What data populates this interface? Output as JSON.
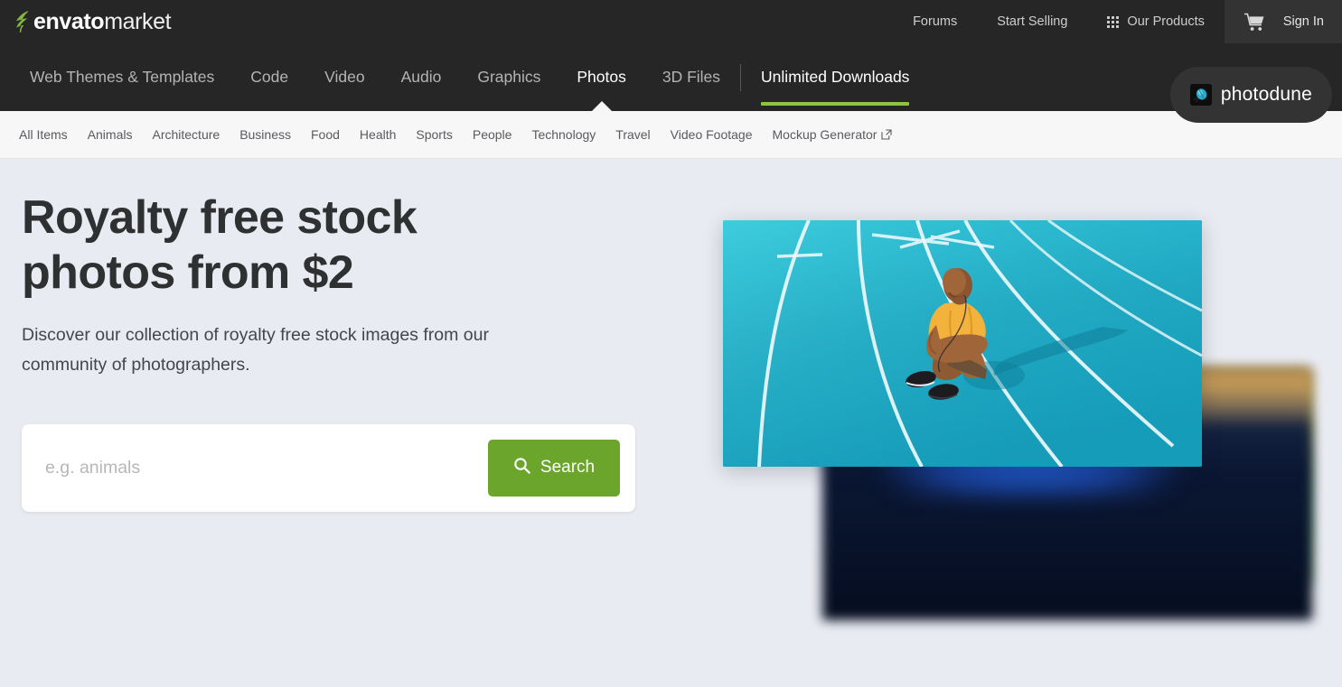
{
  "topbar": {
    "logo": {
      "primary": "envato",
      "secondary": "market",
      "leaf_icon": "envato-leaf-icon",
      "leaf_color": "#82b541"
    },
    "links": [
      {
        "label": "Forums",
        "name": "topnav-forums"
      },
      {
        "label": "Start Selling",
        "name": "topnav-start-selling"
      }
    ],
    "our_products": {
      "label": "Our Products",
      "icon": "grid-icon"
    },
    "sign_in": {
      "label": "Sign In",
      "icon": "cart-icon"
    }
  },
  "mainnav": {
    "items": [
      {
        "label": "Web Themes & Templates",
        "active": false
      },
      {
        "label": "Code",
        "active": false
      },
      {
        "label": "Video",
        "active": false
      },
      {
        "label": "Audio",
        "active": false
      },
      {
        "label": "Graphics",
        "active": false
      },
      {
        "label": "Photos",
        "active": true
      },
      {
        "label": "3D Files",
        "active": false
      }
    ],
    "promo": {
      "label": "Unlimited Downloads",
      "underline_color": "#8cc63f"
    },
    "brand_pill": {
      "label": "photodune",
      "icon": "photodune-beetle-icon"
    }
  },
  "subnav": {
    "items": [
      {
        "label": "All Items",
        "external": false
      },
      {
        "label": "Animals",
        "external": false
      },
      {
        "label": "Architecture",
        "external": false
      },
      {
        "label": "Business",
        "external": false
      },
      {
        "label": "Food",
        "external": false
      },
      {
        "label": "Health",
        "external": false
      },
      {
        "label": "Sports",
        "external": false
      },
      {
        "label": "People",
        "external": false
      },
      {
        "label": "Technology",
        "external": false
      },
      {
        "label": "Travel",
        "external": false
      },
      {
        "label": "Video Footage",
        "external": false
      },
      {
        "label": "Mockup Generator",
        "external": true
      }
    ]
  },
  "hero": {
    "title": "Royalty free stock photos from $2",
    "subtitle": "Discover our collection of royalty free stock images from our community of photographers.",
    "search": {
      "value": "",
      "placeholder": "e.g. animals",
      "button_label": "Search",
      "button_icon": "search-icon",
      "button_color": "#6ba52b"
    },
    "image_stack": {
      "front_alt": "athlete sitting on blue running track",
      "back_images": 2
    },
    "background_color": "#e9ebf2"
  }
}
